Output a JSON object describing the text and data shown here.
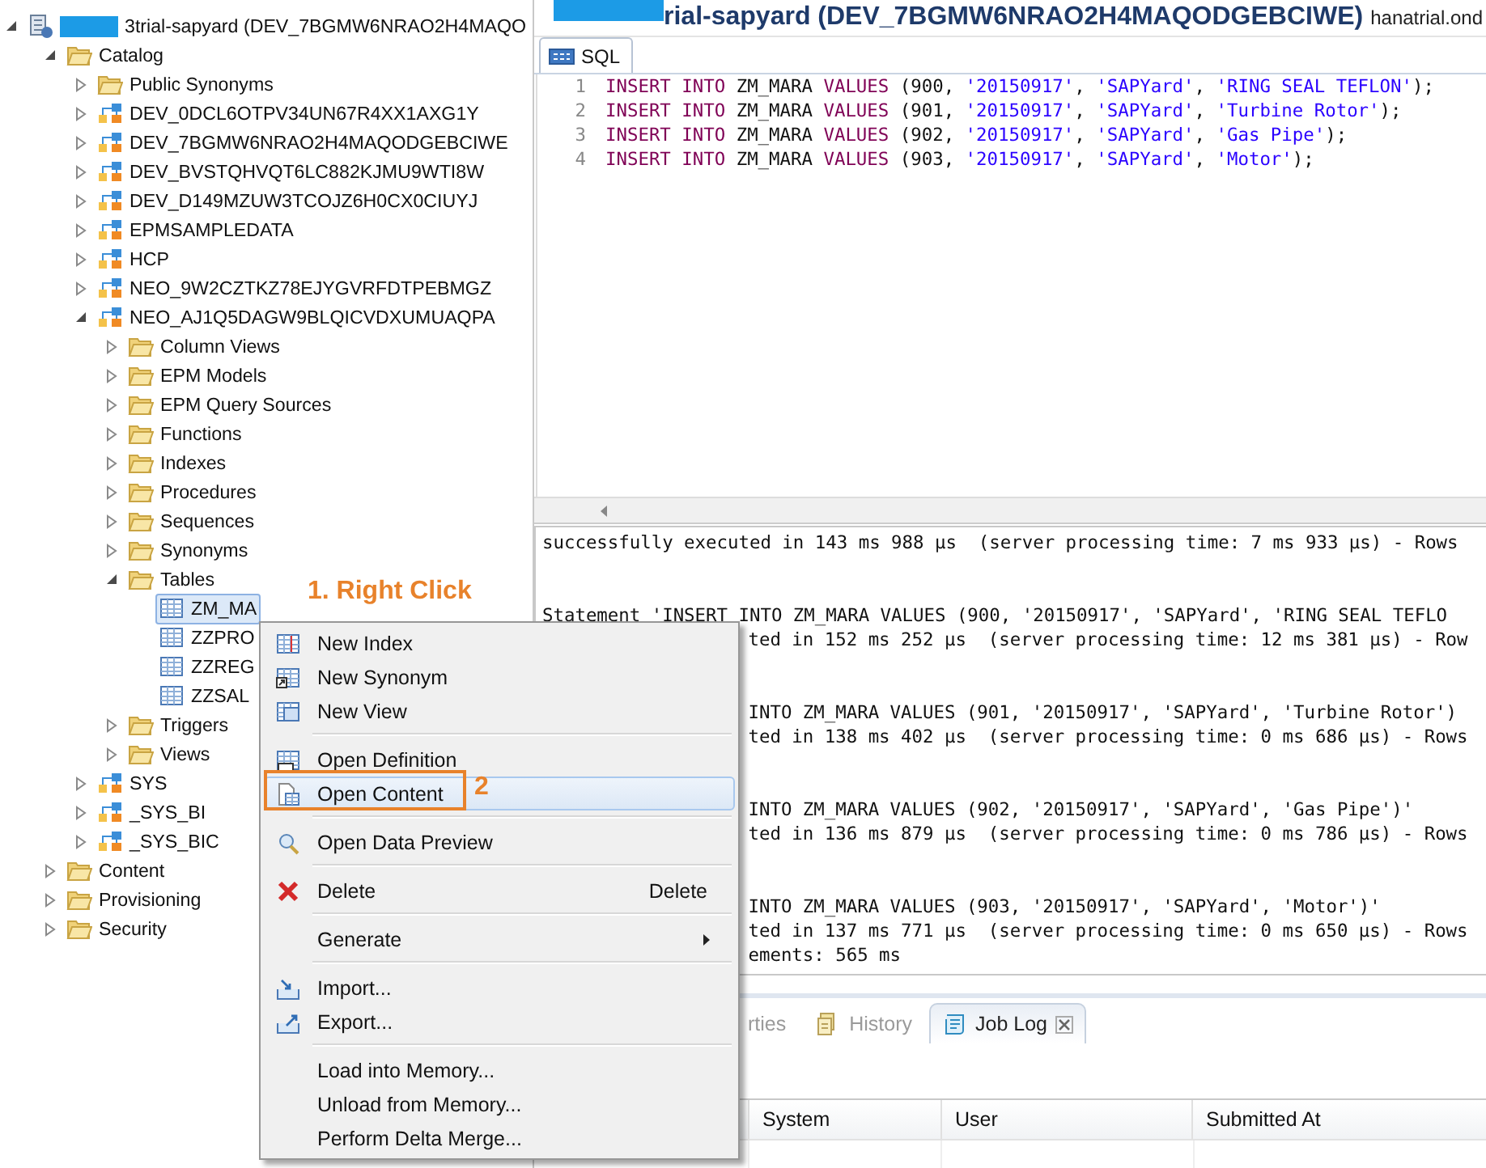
{
  "navigator": {
    "tree": [
      {
        "label": "3trial-sapyard (DEV_7BGMW6NRAO2H4MAQO",
        "kind": "system",
        "redacted": true,
        "expanded": true,
        "selected": false,
        "children": [
          {
            "label": "Catalog",
            "kind": "folder",
            "expanded": true,
            "selected": false,
            "children": [
              {
                "label": "Public Synonyms",
                "kind": "folder",
                "expanded": false,
                "selected": false
              },
              {
                "label": "DEV_0DCL6OTPV34UN67R4XX1AXG1Y",
                "kind": "schema",
                "expanded": false,
                "selected": false
              },
              {
                "label": "DEV_7BGMW6NRAO2H4MAQODGEBCIWE",
                "kind": "schema",
                "expanded": false,
                "selected": false
              },
              {
                "label": "DEV_BVSTQHVQT6LC882KJMU9WTI8W",
                "kind": "schema",
                "expanded": false,
                "selected": false
              },
              {
                "label": "DEV_D149MZUW3TCOJZ6H0CX0CIUYJ",
                "kind": "schema",
                "expanded": false,
                "selected": false
              },
              {
                "label": "EPMSAMPLEDATA",
                "kind": "schema",
                "expanded": false,
                "selected": false
              },
              {
                "label": "HCP",
                "kind": "schema",
                "expanded": false,
                "selected": false
              },
              {
                "label": "NEO_9W2CZTKZ78EJYGVRFDTPEBMGZ",
                "kind": "schema",
                "expanded": false,
                "selected": false
              },
              {
                "label": "NEO_AJ1Q5DAGW9BLQICVDXUMUAQPA",
                "kind": "schema",
                "expanded": true,
                "selected": false,
                "children": [
                  {
                    "label": "Column Views",
                    "kind": "folder",
                    "expanded": false,
                    "selected": false
                  },
                  {
                    "label": "EPM Models",
                    "kind": "folder",
                    "expanded": false,
                    "selected": false
                  },
                  {
                    "label": "EPM Query Sources",
                    "kind": "folder",
                    "expanded": false,
                    "selected": false
                  },
                  {
                    "label": "Functions",
                    "kind": "folder",
                    "expanded": false,
                    "selected": false
                  },
                  {
                    "label": "Indexes",
                    "kind": "folder",
                    "expanded": false,
                    "selected": false
                  },
                  {
                    "label": "Procedures",
                    "kind": "folder",
                    "expanded": false,
                    "selected": false
                  },
                  {
                    "label": "Sequences",
                    "kind": "folder",
                    "expanded": false,
                    "selected": false
                  },
                  {
                    "label": "Synonyms",
                    "kind": "folder",
                    "expanded": false,
                    "selected": false
                  },
                  {
                    "label": "Tables",
                    "kind": "folder",
                    "expanded": true,
                    "selected": false,
                    "children": [
                      {
                        "label": "ZM_MA",
                        "kind": "table",
                        "selected": true
                      },
                      {
                        "label": "ZZPRO",
                        "kind": "table",
                        "selected": false
                      },
                      {
                        "label": "ZZREG",
                        "kind": "table",
                        "selected": false
                      },
                      {
                        "label": "ZZSAL",
                        "kind": "table",
                        "selected": false
                      }
                    ]
                  },
                  {
                    "label": "Triggers",
                    "kind": "folder",
                    "expanded": false,
                    "selected": false
                  },
                  {
                    "label": "Views",
                    "kind": "folder",
                    "expanded": false,
                    "selected": false
                  }
                ]
              },
              {
                "label": "SYS",
                "kind": "schema",
                "expanded": false,
                "selected": false
              },
              {
                "label": "_SYS_BI",
                "kind": "schema",
                "expanded": false,
                "selected": false
              },
              {
                "label": "_SYS_BIC",
                "kind": "schema",
                "expanded": false,
                "selected": false
              }
            ]
          },
          {
            "label": "Content",
            "kind": "folder",
            "expanded": false,
            "selected": false
          },
          {
            "label": "Provisioning",
            "kind": "folder",
            "expanded": false,
            "selected": false
          },
          {
            "label": "Security",
            "kind": "folder",
            "expanded": false,
            "selected": false
          }
        ]
      }
    ]
  },
  "editor": {
    "title": "rial-sapyard (DEV_7BGMW6NRAO2H4MAQODGEBCIWE)",
    "title_redacted": true,
    "host": "hanatrial.ond",
    "tabs": [
      {
        "label": "SQL",
        "selected": true
      }
    ],
    "lines": [
      {
        "number": "1",
        "tokens": [
          {
            "kind": "keyword",
            "text": "INSERT INTO"
          },
          {
            "kind": "plain",
            "text": " ZM_MARA "
          },
          {
            "kind": "keyword",
            "text": "VALUES"
          },
          {
            "kind": "plain",
            "text": " (900, "
          },
          {
            "kind": "string",
            "text": "'20150917'"
          },
          {
            "kind": "plain",
            "text": ", "
          },
          {
            "kind": "string",
            "text": "'SAPYard'"
          },
          {
            "kind": "plain",
            "text": ", "
          },
          {
            "kind": "string",
            "text": "'RING SEAL TEFLON'"
          },
          {
            "kind": "plain",
            "text": ");"
          }
        ]
      },
      {
        "number": "2",
        "tokens": [
          {
            "kind": "keyword",
            "text": "INSERT INTO"
          },
          {
            "kind": "plain",
            "text": " ZM_MARA "
          },
          {
            "kind": "keyword",
            "text": "VALUES"
          },
          {
            "kind": "plain",
            "text": " (901, "
          },
          {
            "kind": "string",
            "text": "'20150917'"
          },
          {
            "kind": "plain",
            "text": ", "
          },
          {
            "kind": "string",
            "text": "'SAPYard'"
          },
          {
            "kind": "plain",
            "text": ", "
          },
          {
            "kind": "string",
            "text": "'Turbine Rotor'"
          },
          {
            "kind": "plain",
            "text": ");"
          }
        ]
      },
      {
        "number": "3",
        "tokens": [
          {
            "kind": "keyword",
            "text": "INSERT INTO"
          },
          {
            "kind": "plain",
            "text": " ZM_MARA "
          },
          {
            "kind": "keyword",
            "text": "VALUES"
          },
          {
            "kind": "plain",
            "text": " (902, "
          },
          {
            "kind": "string",
            "text": "'20150917'"
          },
          {
            "kind": "plain",
            "text": ", "
          },
          {
            "kind": "string",
            "text": "'SAPYard'"
          },
          {
            "kind": "plain",
            "text": ", "
          },
          {
            "kind": "string",
            "text": "'Gas Pipe'"
          },
          {
            "kind": "plain",
            "text": ");"
          }
        ]
      },
      {
        "number": "4",
        "tokens": [
          {
            "kind": "keyword",
            "text": "INSERT INTO"
          },
          {
            "kind": "plain",
            "text": " ZM_MARA "
          },
          {
            "kind": "keyword",
            "text": "VALUES"
          },
          {
            "kind": "plain",
            "text": " (903, "
          },
          {
            "kind": "string",
            "text": "'20150917'"
          },
          {
            "kind": "plain",
            "text": ", "
          },
          {
            "kind": "string",
            "text": "'SAPYard'"
          },
          {
            "kind": "plain",
            "text": ", "
          },
          {
            "kind": "string",
            "text": "'Motor'"
          },
          {
            "kind": "plain",
            "text": ");"
          }
        ]
      }
    ]
  },
  "output": {
    "lines": [
      {
        "kind": "full",
        "text": "successfully executed in 143 ms 988 µs  (server processing time: 7 ms 933 µs) - Rows"
      },
      {
        "kind": "blank"
      },
      {
        "kind": "blank"
      },
      {
        "kind": "full",
        "text": "Statement 'INSERT INTO ZM_MARA VALUES (900, '20150917', 'SAPYard', 'RING SEAL TEFLO"
      },
      {
        "kind": "partial",
        "text": "ted in 152 ms 252 µs  (server processing time: 12 ms 381 µs) - Row"
      },
      {
        "kind": "blank"
      },
      {
        "kind": "blank"
      },
      {
        "kind": "partial",
        "text": "INTO ZM_MARA VALUES (901, '20150917', 'SAPYard', 'Turbine Rotor')"
      },
      {
        "kind": "partial",
        "text": "ted in 138 ms 402 µs  (server processing time: 0 ms 686 µs) - Rows"
      },
      {
        "kind": "blank"
      },
      {
        "kind": "blank"
      },
      {
        "kind": "partial",
        "text": "INTO ZM_MARA VALUES (902, '20150917', 'SAPYard', 'Gas Pipe')'"
      },
      {
        "kind": "partial",
        "text": "ted in 136 ms 879 µs  (server processing time: 0 ms 786 µs) - Rows"
      },
      {
        "kind": "blank"
      },
      {
        "kind": "blank"
      },
      {
        "kind": "partial",
        "text": "INTO ZM_MARA VALUES (903, '20150917', 'SAPYard', 'Motor')'"
      },
      {
        "kind": "partial",
        "text": "ted in 137 ms 771 µs  (server processing time: 0 ms 650 µs) - Rows"
      },
      {
        "kind": "partial",
        "text": "ements: 565 ms"
      }
    ]
  },
  "bottom_panel": {
    "tabs": [
      {
        "label": "rties",
        "kind": "properties",
        "selected": false,
        "closable": false
      },
      {
        "label": "History",
        "kind": "history",
        "selected": false,
        "closable": false
      },
      {
        "label": "Job Log",
        "kind": "job-log",
        "selected": true,
        "closable": true
      }
    ],
    "columns": [
      "System",
      "User",
      "Submitted At"
    ]
  },
  "context_menu": {
    "groups": [
      [
        {
          "label": "New Index",
          "kind": "index",
          "selected": false,
          "submenu": false
        },
        {
          "label": "New Synonym",
          "kind": "synonym",
          "selected": false,
          "submenu": false
        },
        {
          "label": "New View",
          "kind": "view",
          "selected": false,
          "submenu": false
        }
      ],
      [
        {
          "label": "Open Definition",
          "kind": "definition",
          "selected": false,
          "submenu": false
        },
        {
          "label": "Open Content",
          "kind": "content",
          "selected": true,
          "submenu": false
        }
      ],
      [
        {
          "label": "Open Data Preview",
          "kind": "preview",
          "selected": false,
          "submenu": false
        }
      ],
      [
        {
          "label": "Delete",
          "kind": "delete",
          "shortcut": "Delete",
          "selected": false,
          "submenu": false
        }
      ],
      [
        {
          "label": "Generate",
          "selected": false,
          "submenu": true
        }
      ],
      [
        {
          "label": "Import...",
          "kind": "import",
          "selected": false,
          "submenu": false
        },
        {
          "label": "Export...",
          "kind": "export",
          "selected": false,
          "submenu": false
        }
      ],
      [
        {
          "label": "Load into Memory...",
          "selected": false,
          "submenu": false
        },
        {
          "label": "Unload from Memory...",
          "selected": false,
          "submenu": false
        },
        {
          "label": "Perform Delta Merge...",
          "selected": false,
          "submenu": false
        }
      ]
    ]
  },
  "annotations": [
    {
      "kind": "callout",
      "text": "1. Right Click"
    },
    {
      "kind": "boxed",
      "text": "2"
    }
  ]
}
